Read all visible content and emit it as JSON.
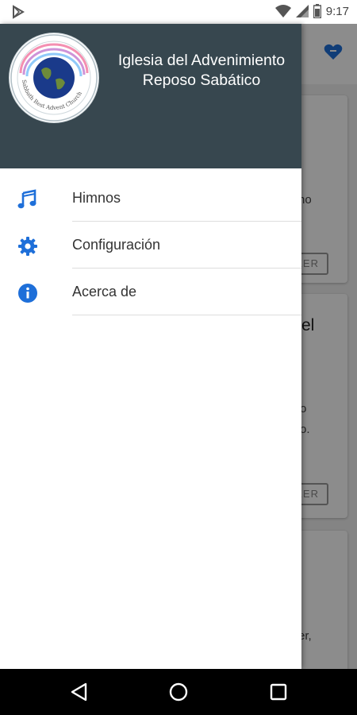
{
  "status_bar": {
    "time": "9:17",
    "icons": [
      "play-store-icon",
      "wifi-icon",
      "cellular-icon",
      "battery-icon"
    ]
  },
  "drawer": {
    "header": {
      "title": "Iglesia del Advenimiento Reposo Sabático",
      "logo_text": "Sabbath Rest Advent Church",
      "background_color": "#37474f"
    },
    "items": [
      {
        "label": "Himnos",
        "icon": "music-note-icon"
      },
      {
        "label": "Configuración",
        "icon": "gear-icon"
      },
      {
        "label": "Acerca de",
        "icon": "info-icon"
      }
    ],
    "accent_color": "#1e6fd9"
  },
  "background": {
    "card1": {
      "fragment": "no",
      "button": "EER"
    },
    "card2": {
      "heading_fragment": "el",
      "fragment1": "o",
      "fragment2": "o.",
      "button": "EER"
    },
    "card3": {
      "fragment": "er,"
    }
  },
  "nav_bar": {
    "icons": [
      "back-icon",
      "home-icon",
      "recents-icon"
    ]
  }
}
